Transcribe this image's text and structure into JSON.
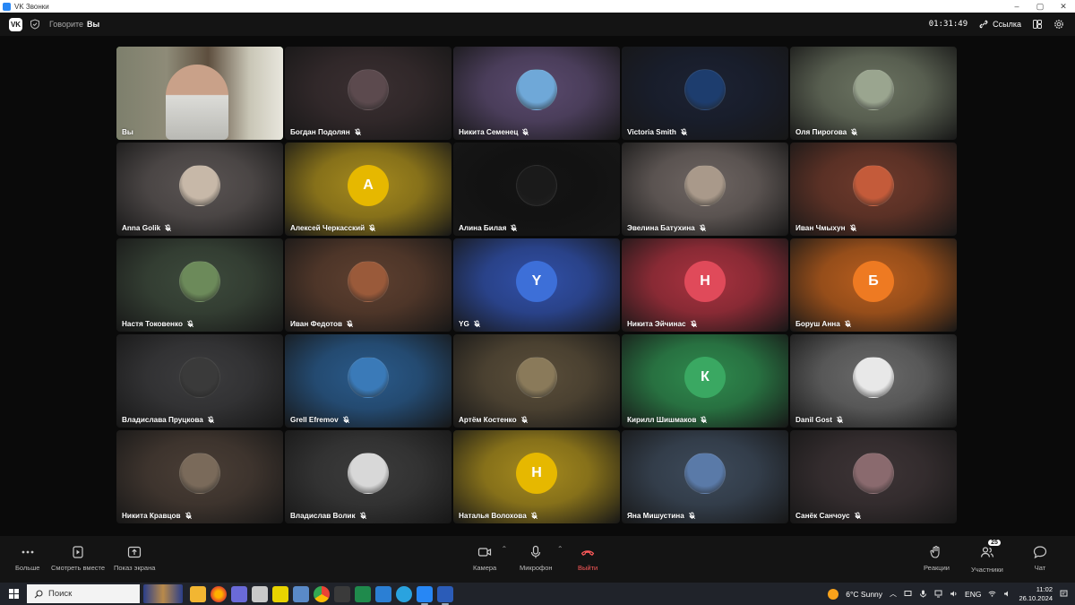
{
  "window": {
    "title": "VK Звонки",
    "controls": [
      "–",
      "▢",
      "✕"
    ]
  },
  "header": {
    "logo": "VK",
    "speaking_label": "Говорите",
    "speaking_name": "Вы",
    "timer": "01:31:49",
    "link_label": "Ссылка"
  },
  "participants": [
    {
      "name": "Вы",
      "avatar_text": "",
      "avatar_color": "#6a6e57",
      "tile_color": "#8a8d78",
      "active": true,
      "self_video": true
    },
    {
      "name": "Богдан Подолян",
      "avatar_text": "",
      "avatar_color": "#5c4a4e",
      "tile_color": "#3a2f31"
    },
    {
      "name": "Никита Семенец",
      "avatar_text": "",
      "avatar_color": "#6fa8d8",
      "tile_color": "#5a4a6e"
    },
    {
      "name": "Victoria Smith",
      "avatar_text": "",
      "avatar_color": "#1d3d6e",
      "tile_color": "#1c2233"
    },
    {
      "name": "Оля Пирогова",
      "avatar_text": "",
      "avatar_color": "#9aa58f",
      "tile_color": "#6b7361"
    },
    {
      "name": "Anna Golik",
      "avatar_text": "",
      "avatar_color": "#c7b8a8",
      "tile_color": "#5a5453"
    },
    {
      "name": "Алексей Черкасский",
      "avatar_text": "А",
      "avatar_color": "#e6b800",
      "tile_color": "#a58a1e"
    },
    {
      "name": "Алина Билая",
      "avatar_text": "",
      "avatar_color": "#1a1a1a",
      "tile_color": "#141414"
    },
    {
      "name": "Эвелина Батухина",
      "avatar_text": "",
      "avatar_color": "#a9998a",
      "tile_color": "#6e6562"
    },
    {
      "name": "Иван Чмыхун",
      "avatar_text": "",
      "avatar_color": "#c45b3a",
      "tile_color": "#6e3a2c"
    },
    {
      "name": "Настя Токовенко",
      "avatar_text": "",
      "avatar_color": "#6c8a5a",
      "tile_color": "#3d4a3c"
    },
    {
      "name": "Иван Федотов",
      "avatar_text": "",
      "avatar_color": "#9a5a3a",
      "tile_color": "#5e4030"
    },
    {
      "name": "YG",
      "avatar_text": "Y",
      "avatar_color": "#3d6fd8",
      "tile_color": "#3150a8"
    },
    {
      "name": "Никита Эйчинас",
      "avatar_text": "Н",
      "avatar_color": "#e04a5a",
      "tile_color": "#a8323f"
    },
    {
      "name": "Боруш Анна",
      "avatar_text": "Б",
      "avatar_color": "#ee7a22",
      "tile_color": "#b85e1e"
    },
    {
      "name": "Владислава Пруцкова",
      "avatar_text": "",
      "avatar_color": "#3a3a3a",
      "tile_color": "#3c3c3e"
    },
    {
      "name": "Grell Efremov",
      "avatar_text": "",
      "avatar_color": "#3a7ab8",
      "tile_color": "#2a5a8a"
    },
    {
      "name": "Артём Костенко",
      "avatar_text": "",
      "avatar_color": "#8a7a5a",
      "tile_color": "#5a4e3a"
    },
    {
      "name": "Кирилл Шишмаков",
      "avatar_text": "К",
      "avatar_color": "#3aa862",
      "tile_color": "#2f8a4e"
    },
    {
      "name": "Danil Gost",
      "avatar_text": "",
      "avatar_color": "#e8e8e8",
      "tile_color": "#6a6a6a"
    },
    {
      "name": "Никита Кравцов",
      "avatar_text": "",
      "avatar_color": "#7a6a5a",
      "tile_color": "#4a3e36"
    },
    {
      "name": "Владислав Волик",
      "avatar_text": "",
      "avatar_color": "#d8d8d8",
      "tile_color": "#3c3c3c"
    },
    {
      "name": "Наталья Волохова",
      "avatar_text": "Н",
      "avatar_color": "#e6b800",
      "tile_color": "#a58a1e"
    },
    {
      "name": "Яна Мишустина",
      "avatar_text": "",
      "avatar_color": "#5a7aa8",
      "tile_color": "#3d4a5a"
    },
    {
      "name": "Санёк Санчоус",
      "avatar_text": "",
      "avatar_color": "#8a6a6e",
      "tile_color": "#3d3436"
    }
  ],
  "toolbar": {
    "more": "Больше",
    "watch_together": "Смотреть вместе",
    "screen_share": "Показ экрана",
    "camera": "Камера",
    "microphone": "Микрофон",
    "leave": "Выйти",
    "reactions": "Реакции",
    "participants": "Участники",
    "participants_count": "25",
    "chat": "Чат"
  },
  "taskbar": {
    "search_placeholder": "Поиск",
    "weather": "6°C  Sunny",
    "lang": "ENG",
    "time": "11:02",
    "date": "26.10.2024"
  },
  "colors": {
    "accent_green": "#4bb34b",
    "leave_red": "#ff5a5a",
    "background": "#0a0a0a"
  }
}
